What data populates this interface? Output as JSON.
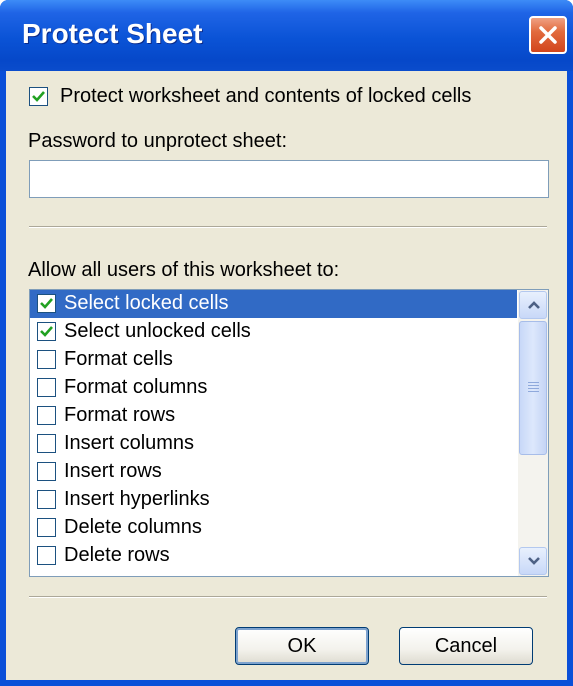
{
  "window": {
    "title": "Protect Sheet"
  },
  "protect": {
    "checkbox_label": "Protect worksheet and contents of locked cells",
    "checked": true
  },
  "password": {
    "label": "Password to unprotect sheet:",
    "value": ""
  },
  "permissions": {
    "label": "Allow all users of this worksheet to:",
    "items": [
      {
        "label": "Select locked cells",
        "checked": true,
        "selected": true
      },
      {
        "label": "Select unlocked cells",
        "checked": true,
        "selected": false
      },
      {
        "label": "Format cells",
        "checked": false,
        "selected": false
      },
      {
        "label": "Format columns",
        "checked": false,
        "selected": false
      },
      {
        "label": "Format rows",
        "checked": false,
        "selected": false
      },
      {
        "label": "Insert columns",
        "checked": false,
        "selected": false
      },
      {
        "label": "Insert rows",
        "checked": false,
        "selected": false
      },
      {
        "label": "Insert hyperlinks",
        "checked": false,
        "selected": false
      },
      {
        "label": "Delete columns",
        "checked": false,
        "selected": false
      },
      {
        "label": "Delete rows",
        "checked": false,
        "selected": false
      }
    ]
  },
  "buttons": {
    "ok": "OK",
    "cancel": "Cancel"
  },
  "colors": {
    "titlebar": "#0a53d6",
    "selection": "#316ac5",
    "checkmark": "#21a121",
    "dialog_bg": "#ece9d8"
  },
  "icons": {
    "close": "close-icon",
    "check": "checkmark-icon",
    "scroll_up": "chevron-up-icon",
    "scroll_down": "chevron-down-icon"
  }
}
